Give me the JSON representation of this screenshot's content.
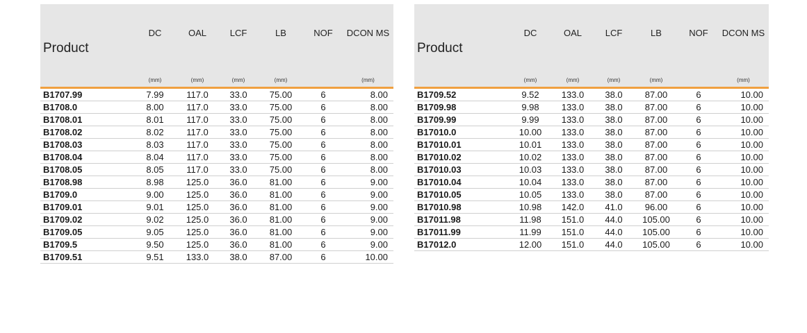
{
  "columns": {
    "product": "Product",
    "dc": "DC",
    "oal": "OAL",
    "lcf": "LCF",
    "lb": "LB",
    "nof": "NOF",
    "dcon": "DCON MS"
  },
  "units": {
    "dc": "(mm)",
    "oal": "(mm)",
    "lcf": "(mm)",
    "lb": "(mm)",
    "nof": "",
    "dcon": "(mm)"
  },
  "left_rows": [
    [
      "B1707.99",
      "7.99",
      "117.0",
      "33.0",
      "75.00",
      "6",
      "8.00"
    ],
    [
      "B1708.0",
      "8.00",
      "117.0",
      "33.0",
      "75.00",
      "6",
      "8.00"
    ],
    [
      "B1708.01",
      "8.01",
      "117.0",
      "33.0",
      "75.00",
      "6",
      "8.00"
    ],
    [
      "B1708.02",
      "8.02",
      "117.0",
      "33.0",
      "75.00",
      "6",
      "8.00"
    ],
    [
      "B1708.03",
      "8.03",
      "117.0",
      "33.0",
      "75.00",
      "6",
      "8.00"
    ],
    [
      "B1708.04",
      "8.04",
      "117.0",
      "33.0",
      "75.00",
      "6",
      "8.00"
    ],
    [
      "B1708.05",
      "8.05",
      "117.0",
      "33.0",
      "75.00",
      "6",
      "8.00"
    ],
    [
      "B1708.98",
      "8.98",
      "125.0",
      "36.0",
      "81.00",
      "6",
      "9.00"
    ],
    [
      "B1709.0",
      "9.00",
      "125.0",
      "36.0",
      "81.00",
      "6",
      "9.00"
    ],
    [
      "B1709.01",
      "9.01",
      "125.0",
      "36.0",
      "81.00",
      "6",
      "9.00"
    ],
    [
      "B1709.02",
      "9.02",
      "125.0",
      "36.0",
      "81.00",
      "6",
      "9.00"
    ],
    [
      "B1709.05",
      "9.05",
      "125.0",
      "36.0",
      "81.00",
      "6",
      "9.00"
    ],
    [
      "B1709.5",
      "9.50",
      "125.0",
      "36.0",
      "81.00",
      "6",
      "9.00"
    ],
    [
      "B1709.51",
      "9.51",
      "133.0",
      "38.0",
      "87.00",
      "6",
      "10.00"
    ]
  ],
  "right_rows": [
    [
      "B1709.52",
      "9.52",
      "133.0",
      "38.0",
      "87.00",
      "6",
      "10.00"
    ],
    [
      "B1709.98",
      "9.98",
      "133.0",
      "38.0",
      "87.00",
      "6",
      "10.00"
    ],
    [
      "B1709.99",
      "9.99",
      "133.0",
      "38.0",
      "87.00",
      "6",
      "10.00"
    ],
    [
      "B17010.0",
      "10.00",
      "133.0",
      "38.0",
      "87.00",
      "6",
      "10.00"
    ],
    [
      "B17010.01",
      "10.01",
      "133.0",
      "38.0",
      "87.00",
      "6",
      "10.00"
    ],
    [
      "B17010.02",
      "10.02",
      "133.0",
      "38.0",
      "87.00",
      "6",
      "10.00"
    ],
    [
      "B17010.03",
      "10.03",
      "133.0",
      "38.0",
      "87.00",
      "6",
      "10.00"
    ],
    [
      "B17010.04",
      "10.04",
      "133.0",
      "38.0",
      "87.00",
      "6",
      "10.00"
    ],
    [
      "B17010.05",
      "10.05",
      "133.0",
      "38.0",
      "87.00",
      "6",
      "10.00"
    ],
    [
      "B17010.98",
      "10.98",
      "142.0",
      "41.0",
      "96.00",
      "6",
      "10.00"
    ],
    [
      "B17011.98",
      "11.98",
      "151.0",
      "44.0",
      "105.00",
      "6",
      "10.00"
    ],
    [
      "B17011.99",
      "11.99",
      "151.0",
      "44.0",
      "105.00",
      "6",
      "10.00"
    ],
    [
      "B17012.0",
      "12.00",
      "151.0",
      "44.0",
      "105.00",
      "6",
      "10.00"
    ]
  ],
  "colors": {
    "header_bg": "#e6e6e6",
    "accent_rule": "#f0a040",
    "row_rule": "#cfcfcf"
  }
}
